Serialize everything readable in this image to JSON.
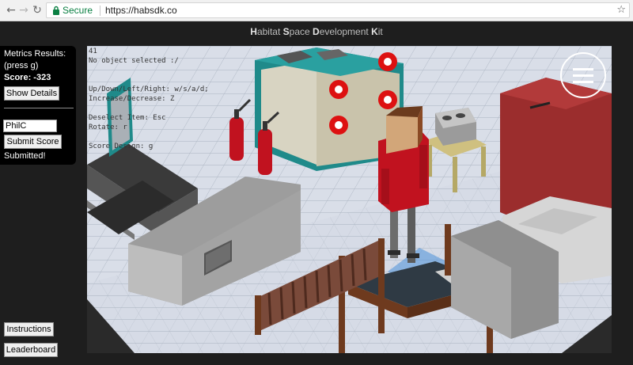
{
  "browser": {
    "secure_label": "Secure",
    "url": "https://habsdk.co"
  },
  "page": {
    "title_parts": [
      {
        "t": "H",
        "b": true
      },
      {
        "t": "abitat ",
        "b": false
      },
      {
        "t": "S",
        "b": true
      },
      {
        "t": "pace ",
        "b": false
      },
      {
        "t": "D",
        "b": true
      },
      {
        "t": "evelopment ",
        "b": false
      },
      {
        "t": "K",
        "b": true
      },
      {
        "t": "it",
        "b": false
      }
    ]
  },
  "metrics": {
    "heading": "Metrics Results:",
    "hint": "(press g)",
    "score_label": "Score: -323",
    "show_details": "Show Details",
    "name_value": "PhilC",
    "submit_label": "Submit Score",
    "status": "Submitted!"
  },
  "bottom_buttons": {
    "instructions": "Instructions",
    "leaderboard": "Leaderboard"
  },
  "viewport": {
    "overlay_lines": [
      "41",
      "No object selected :/",
      "",
      "",
      "Up/Down/Left/Right: w/s/a/d;",
      "Increase/Decrease: Z",
      "",
      "Deselect Item: Esc",
      "Rotate: r",
      "",
      "Score Design: g"
    ]
  },
  "colors": {
    "floor": "#d7dde8",
    "grid": "#b3bcc9",
    "wall_grey": "#a9a9a9",
    "red": "#c1121f",
    "teal": "#1f8a8a",
    "maroon": "#9b2d2d",
    "wood": "#6e3a1e"
  }
}
